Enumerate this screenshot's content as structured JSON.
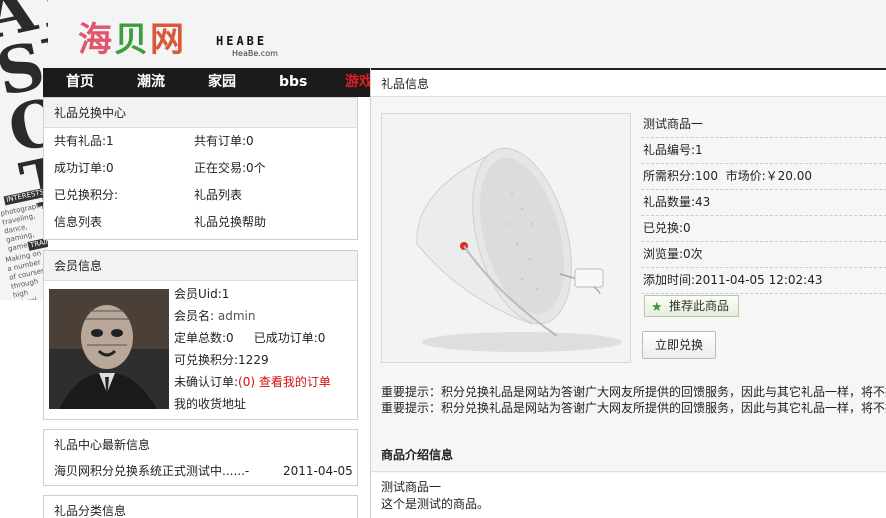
{
  "site": {
    "logo_cn": [
      "海",
      "贝",
      "网"
    ],
    "logo_en": "HEABE",
    "logo_sub": "HeaBe.com"
  },
  "nav": [
    "首页",
    "潮流",
    "家园",
    "bbs",
    "游戏"
  ],
  "exchange_center": {
    "title": "礼品兑换中心",
    "rows": [
      [
        "共有礼品:1",
        "共有订单:0"
      ],
      [
        "成功订单:0",
        "正在交易:0个"
      ],
      [
        "已兑换积分:",
        "礼品列表"
      ],
      [
        "信息列表",
        "礼品兑换帮助"
      ]
    ]
  },
  "member": {
    "title": "会员信息",
    "uid": "会员Uid:1",
    "name_label": "会员名: ",
    "name": "admin",
    "orders_total": "定单总数:0",
    "orders_done": "已成功订单:0",
    "points": "可兑换积分:1229",
    "unconfirmed_label": "未确认订单:",
    "unconfirmed_count": "(0)",
    "view_orders": "查看我的订单",
    "address": "我的收货地址"
  },
  "news": {
    "title": "礼品中心最新信息",
    "item_text": "海贝网积分兑换系统正式测试中......-",
    "item_date": "2011-04-05"
  },
  "category": {
    "title": "礼品分类信息"
  },
  "gift": {
    "panel_title": "礼品信息",
    "name": "测试商品一",
    "number": "礼品编号:1",
    "points": "所需积分:100",
    "market_price": "市场价:￥20.00",
    "quantity": "礼品数量:43",
    "exchanged": "已兑换:0",
    "views": "浏览量:0次",
    "added": "添加时间:2011-04-05 12:02:43",
    "recommend_btn": "推荐此商品",
    "exchange_btn": "立即兑换",
    "notice1": "重要提示：积分兑换礼品是网站为答谢广大网友所提供的回馈服务，因此与其它礼品一样，将不提供",
    "notice2": "重要提示：积分兑换礼品是网站为答谢广大网友所提供的回馈服务，因此与其它礼品一样，将不提供",
    "intro_title": "商品介绍信息",
    "intro_line1": "测试商品一",
    "intro_line2": "这个是测试的商品。"
  },
  "poster_text": {
    "big": [
      "ATI",
      "SH",
      "OU",
      "TRE"
    ],
    "interests": "INTERESTS",
    "desc": "photography, traveling, dance, gaming, games",
    "training": "TRAINING",
    "training_desc": "Making on a number of courses through high school"
  },
  "colors": {
    "nav_bg": "#1b1b1b",
    "nav_hot": "#e02020",
    "accent_red": "#d01010",
    "logo_pink": "#e0566e",
    "logo_green": "#3c9e3c"
  }
}
